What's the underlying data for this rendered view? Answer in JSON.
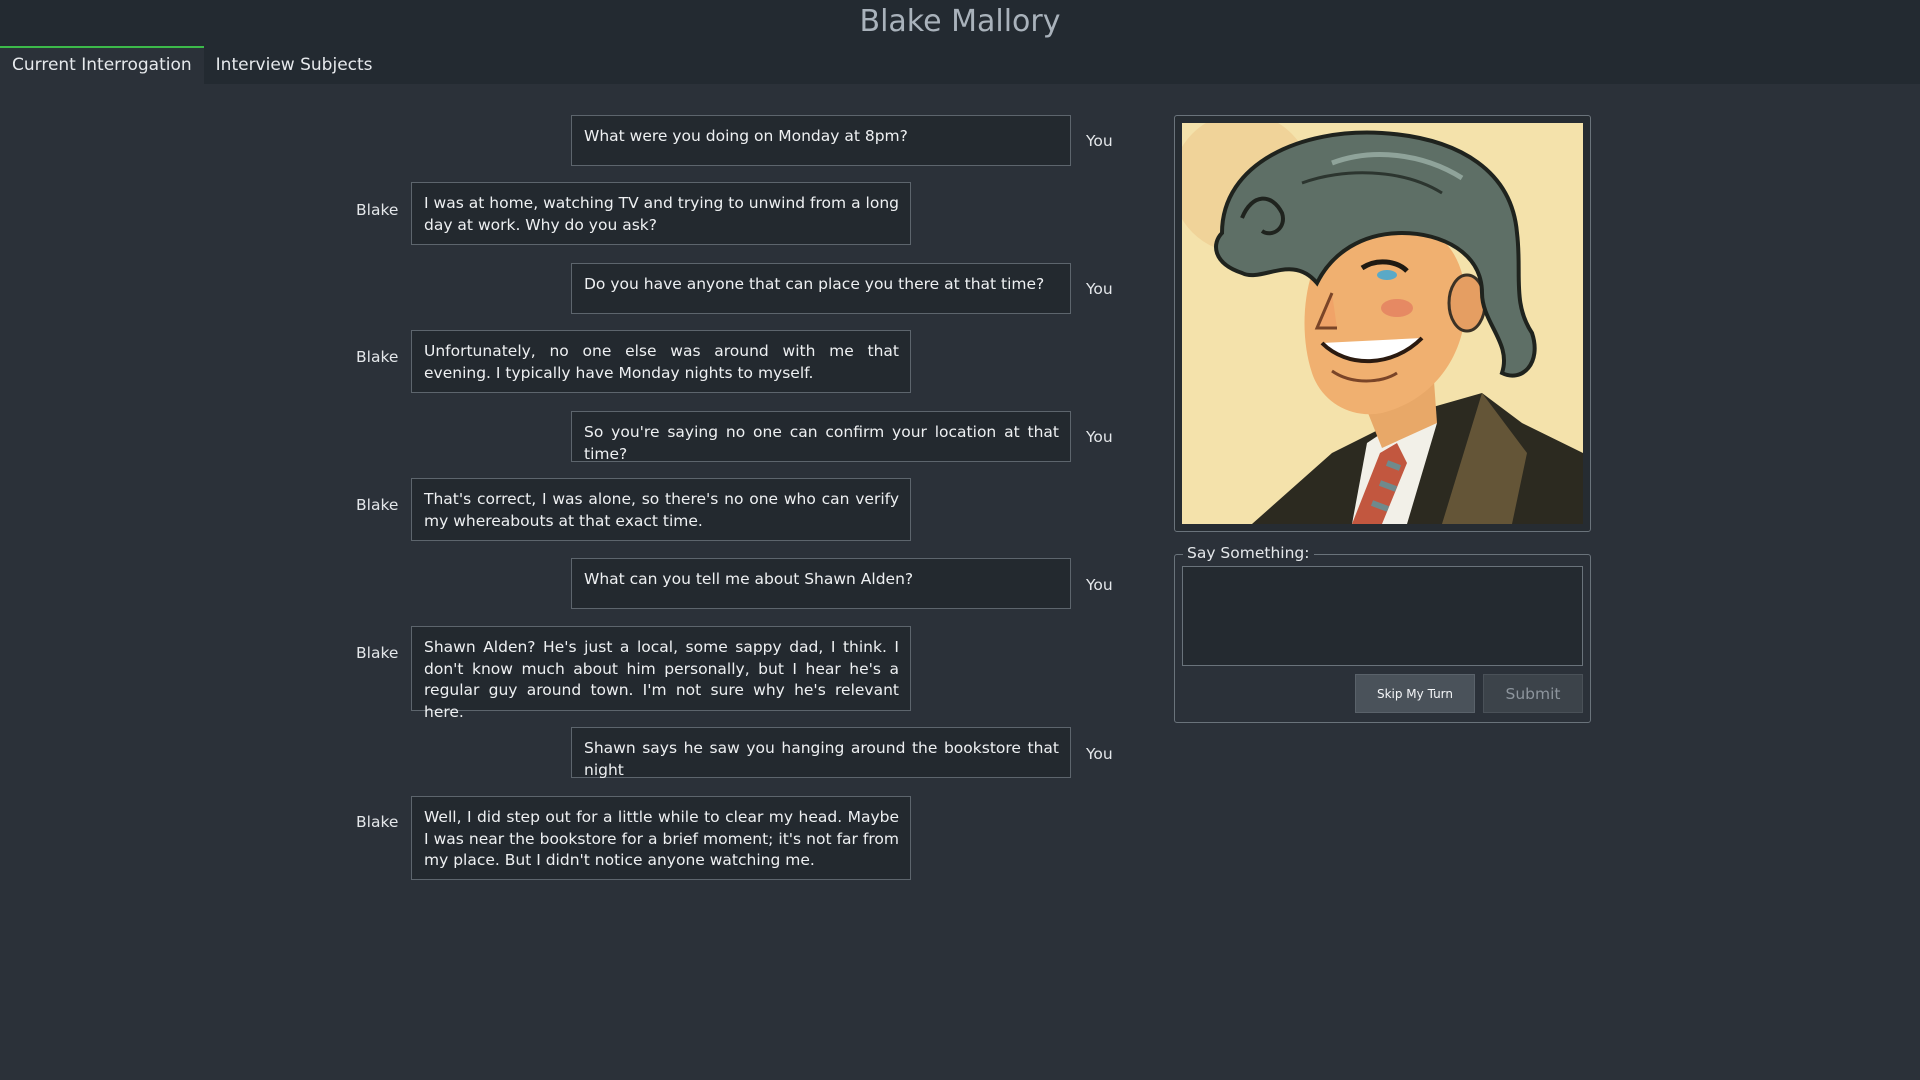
{
  "app": {
    "title": "Blake Mallory"
  },
  "tabs": [
    {
      "label": "Current Interrogation",
      "active": true
    },
    {
      "label": "Interview Subjects",
      "active": false
    }
  ],
  "conversation": [
    {
      "speaker": "You",
      "text": "What were you doing on Monday at 8pm?"
    },
    {
      "speaker": "Blake",
      "text": "I was at home, watching TV and trying to unwind from a long day at work. Why do you ask?"
    },
    {
      "speaker": "You",
      "text": "Do you have anyone that can place you there at that time?"
    },
    {
      "speaker": "Blake",
      "text": "Unfortunately, no one else was around with me that evening. I typically have Monday nights to myself."
    },
    {
      "speaker": "You",
      "text": "So you're saying no one can confirm your location at that time?"
    },
    {
      "speaker": "Blake",
      "text": "That's correct, I was alone, so there's no one who can verify my whereabouts at that exact time."
    },
    {
      "speaker": "You",
      "text": "What can you tell me about Shawn Alden?"
    },
    {
      "speaker": "Blake",
      "text": "Shawn Alden? He's just a local, some sappy dad, I think. I don't know much about him personally, but I hear he's a regular guy around town. I'm not sure why he's relevant here."
    },
    {
      "speaker": "You",
      "text": "Shawn says he saw you hanging around the bookstore that night"
    },
    {
      "speaker": "Blake",
      "text": "Well, I did step out for a little while to clear my head. Maybe I was near the bookstore for a brief moment; it's not far from my place. But I didn't notice anyone watching me."
    }
  ],
  "say_box": {
    "legend": "Say Something:",
    "input_value": "",
    "skip_label": "Skip My Turn",
    "submit_label": "Submit"
  },
  "colors": {
    "background": "#2b3139",
    "topbar": "#232a31",
    "active_tab_accent": "#3cba4a",
    "bubble_bg": "#23292f",
    "bubble_border": "#5d656d"
  }
}
